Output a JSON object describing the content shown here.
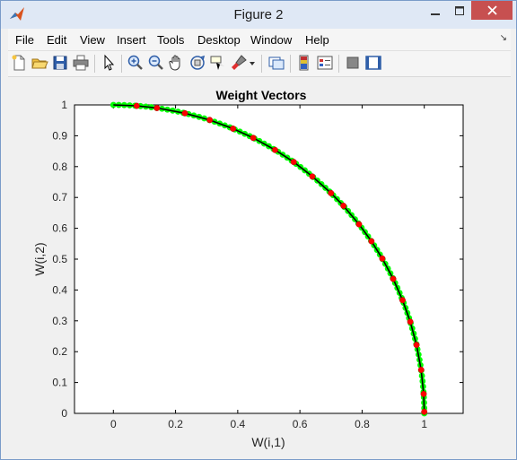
{
  "window": {
    "title": "Figure 2"
  },
  "menu": {
    "items": [
      "File",
      "Edit",
      "View",
      "Insert",
      "Tools",
      "Desktop",
      "Window",
      "Help"
    ]
  },
  "toolbar": {
    "buttons": [
      "new-figure-icon",
      "open-file-icon",
      "save-icon",
      "print-icon",
      "pointer-icon",
      "zoom-in-icon",
      "zoom-out-icon",
      "pan-hand-icon",
      "rotate-3d-icon",
      "data-cursor-icon",
      "brush-icon",
      "brush-dropdown-icon",
      "link-plot-icon",
      "colorbar-icon",
      "legend-icon",
      "hide-plot-tools-icon",
      "show-plot-tools-icon"
    ]
  },
  "chart_data": {
    "type": "scatter",
    "title": "Weight Vectors",
    "xlabel": "W(i,1)",
    "ylabel": "W(i,2)",
    "xlim": [
      -0.125,
      1.125
    ],
    "ylim": [
      0,
      1
    ],
    "xticks": [
      "0",
      "0.2",
      "0.4",
      "0.6",
      "0.8",
      "1"
    ],
    "yticks": [
      "0",
      "0.1",
      "0.2",
      "0.3",
      "0.4",
      "0.5",
      "0.6",
      "0.7",
      "0.8",
      "0.9",
      "1"
    ],
    "colors": {
      "arc": "#000000",
      "green_markers": "#00ff00",
      "red_markers": "#ff0000"
    },
    "series": [
      {
        "values": [
          [
            0.075,
            0.997
          ],
          [
            0.14,
            0.99
          ],
          [
            0.23,
            0.973
          ],
          [
            0.31,
            0.951
          ],
          [
            0.385,
            0.923
          ],
          [
            0.45,
            0.893
          ],
          [
            0.52,
            0.854
          ],
          [
            0.58,
            0.815
          ],
          [
            0.64,
            0.768
          ],
          [
            0.7,
            0.714
          ],
          [
            0.74,
            0.673
          ],
          [
            0.79,
            0.613
          ],
          [
            0.83,
            0.558
          ],
          [
            0.865,
            0.502
          ],
          [
            0.9,
            0.436
          ],
          [
            0.93,
            0.367
          ],
          [
            0.955,
            0.297
          ],
          [
            0.975,
            0.222
          ],
          [
            0.99,
            0.141
          ],
          [
            0.998,
            0.063
          ],
          [
            1.0,
            0.005
          ]
        ]
      }
    ]
  }
}
